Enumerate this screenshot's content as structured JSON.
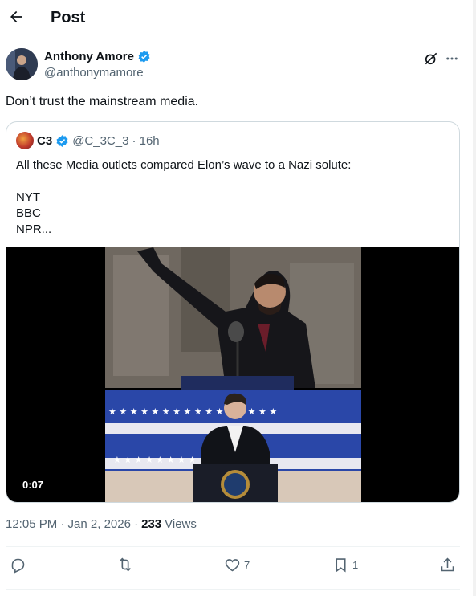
{
  "header": {
    "title": "Post"
  },
  "author": {
    "name": "Anthony Amore",
    "handle": "@anthonymamore",
    "verified": true
  },
  "post": {
    "text": "Don’t trust the mainstream media."
  },
  "quote": {
    "name": "C3",
    "handle": "@C_3C_3",
    "time": "· 16h",
    "lines": [
      "All these Media outlets compared Elon’s wave to a Nazi solute:",
      "",
      "NYT",
      "BBC",
      "NPR..."
    ],
    "video": {
      "duration": "0:07"
    }
  },
  "meta": {
    "time": "12:05 PM · Jan 2, 2026 ·",
    "views_count": "233",
    "views_label": "Views"
  },
  "actions": {
    "reply": "",
    "repost": "",
    "like": "7",
    "bookmark": "1"
  },
  "colors": {
    "verified": "#1d9bf0",
    "secondary_text": "#536471",
    "border": "#cfd9de"
  },
  "icons": [
    "back-arrow-icon",
    "verified-badge-icon",
    "grok-icon",
    "more-icon",
    "reply-icon",
    "repost-icon",
    "like-icon",
    "bookmark-icon",
    "share-icon"
  ]
}
